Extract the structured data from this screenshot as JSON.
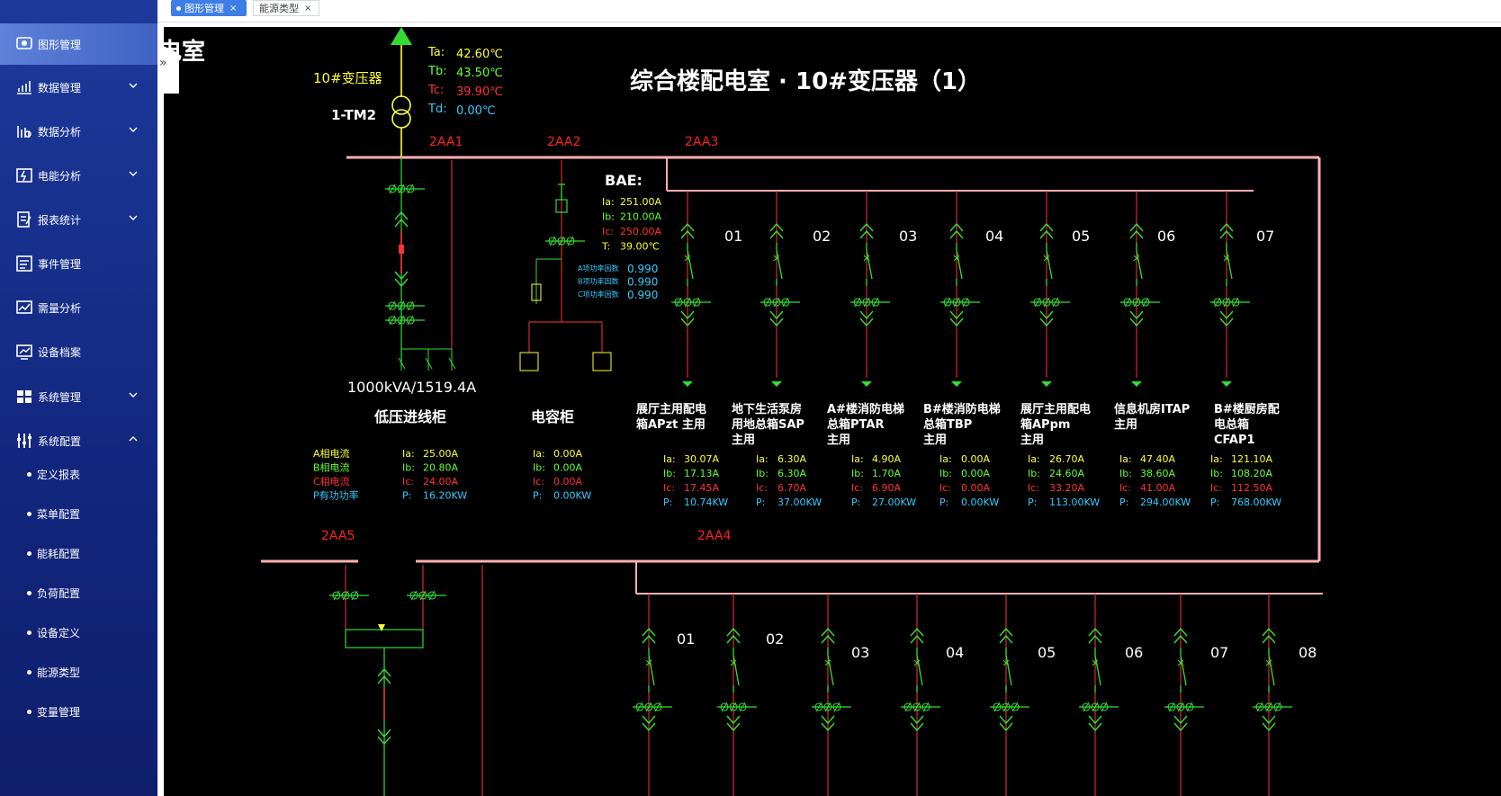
{
  "sidebar": {
    "items": [
      {
        "label": "图形管理",
        "icon": "display-icon",
        "active": true,
        "expandable": false
      },
      {
        "label": "数据管理",
        "icon": "bar-chart-icon",
        "active": false,
        "expandable": true
      },
      {
        "label": "数据分析",
        "icon": "analysis-icon",
        "active": false,
        "expandable": true
      },
      {
        "label": "电能分析",
        "icon": "energy-icon",
        "active": false,
        "expandable": true
      },
      {
        "label": "报表统计",
        "icon": "report-icon",
        "active": false,
        "expandable": true
      },
      {
        "label": "事件管理",
        "icon": "event-icon",
        "active": false,
        "expandable": false
      },
      {
        "label": "需量分析",
        "icon": "demand-icon",
        "active": false,
        "expandable": false
      },
      {
        "label": "设备档案",
        "icon": "device-icon",
        "active": false,
        "expandable": false
      },
      {
        "label": "系统管理",
        "icon": "windows-icon",
        "active": false,
        "expandable": true
      },
      {
        "label": "系统配置",
        "icon": "sliders-icon",
        "active": false,
        "expandable": true,
        "expanded": true
      }
    ],
    "sub_items": [
      "定义报表",
      "菜单配置",
      "能耗配置",
      "负荷配置",
      "设备定义",
      "能源类型",
      "变量管理"
    ]
  },
  "tabs": [
    {
      "label": "图形管理",
      "active": true
    },
    {
      "label": "能源类型",
      "active": false
    }
  ],
  "colors": {
    "ta": "#ffff33",
    "tb": "#66ff33",
    "tc": "#ff3333",
    "td": "#33ccff",
    "red_label": "#ff2020",
    "bus": "#ffb0b0",
    "switch": "#33dd33",
    "white": "#ffffff"
  },
  "diagram": {
    "page_title_fragment": "电室",
    "title": "综合楼配电室 · 10#变压器（1）",
    "transformer": {
      "name": "10#变压器",
      "id": "1-TM2",
      "capacity": "1000kVA/1519.4A",
      "temps": [
        {
          "label": "Ta:",
          "value": "42.60℃"
        },
        {
          "label": "Tb:",
          "value": "43.50℃"
        },
        {
          "label": "Tc:",
          "value": "39.90℃"
        },
        {
          "label": "Td:",
          "value": "0.00℃"
        }
      ]
    },
    "bus_labels": [
      "2AA1",
      "2AA2",
      "2AA3",
      "2AA5",
      "2AA4"
    ],
    "incoming": {
      "name": "低压进线柜",
      "labels": [
        "A相电流",
        "B相电流",
        "C相电流",
        "P有功功率"
      ],
      "keys": [
        "Ia:",
        "Ib:",
        "Ic:",
        "P:"
      ],
      "values": [
        "25.00A",
        "20.80A",
        "24.00A",
        "16.20KW"
      ]
    },
    "capacitor": {
      "name": "电容柜",
      "keys": [
        "Ia:",
        "Ib:",
        "Ic:",
        "P:"
      ],
      "values": [
        "0.00A",
        "0.00A",
        "0.00A",
        "0.00KW"
      ]
    },
    "bae": {
      "title": "BAE:",
      "keys": [
        "Ia:",
        "Ib:",
        "Ic:",
        "T:"
      ],
      "values": [
        "251.00A",
        "210.00A",
        "250.00A",
        "39.00℃"
      ],
      "pf_labels": [
        "A项功率因数",
        "B项功率因数",
        "C项功率因数"
      ],
      "pf_values": [
        "0.990",
        "0.990",
        "0.990"
      ]
    },
    "feeders_2aa3": [
      {
        "num": "01",
        "name": [
          "展厅主用配电",
          "箱APzt 主用"
        ],
        "values": [
          "30.07A",
          "17.13A",
          "17.45A",
          "10.74KW"
        ]
      },
      {
        "num": "02",
        "name": [
          "地下生活泵房",
          "用地总箱SAP",
          "主用"
        ],
        "values": [
          "6.30A",
          "6.30A",
          "6.70A",
          "37.00KW"
        ]
      },
      {
        "num": "03",
        "name": [
          "A#楼消防电梯",
          "总箱PTAR",
          "主用"
        ],
        "values": [
          "4.90A",
          "1.70A",
          "6.90A",
          "27.00KW"
        ]
      },
      {
        "num": "04",
        "name": [
          "B#楼消防电梯",
          "总箱TBP",
          "主用"
        ],
        "values": [
          "0.00A",
          "0.00A",
          "0.00A",
          "0.00KW"
        ]
      },
      {
        "num": "05",
        "name": [
          "展厅主用配电",
          "箱APpm",
          "主用"
        ],
        "values": [
          "26.70A",
          "24.60A",
          "33.20A",
          "113.00KW"
        ]
      },
      {
        "num": "06",
        "name": [
          "信息机房ITAP",
          "主用"
        ],
        "values": [
          "47.40A",
          "38.60A",
          "41.00A",
          "294.00KW"
        ]
      },
      {
        "num": "07",
        "name": [
          "B#楼厨房配",
          "电总箱",
          "CFAP1"
        ],
        "values": [
          "121.10A",
          "108.20A",
          "112.50A",
          "768.00KW"
        ]
      }
    ],
    "feeder_keys": [
      "Ia:",
      "Ib:",
      "Ic:",
      "P:"
    ],
    "feeders_2aa4": [
      "01",
      "02",
      "03",
      "04",
      "05",
      "06",
      "07",
      "08"
    ]
  }
}
